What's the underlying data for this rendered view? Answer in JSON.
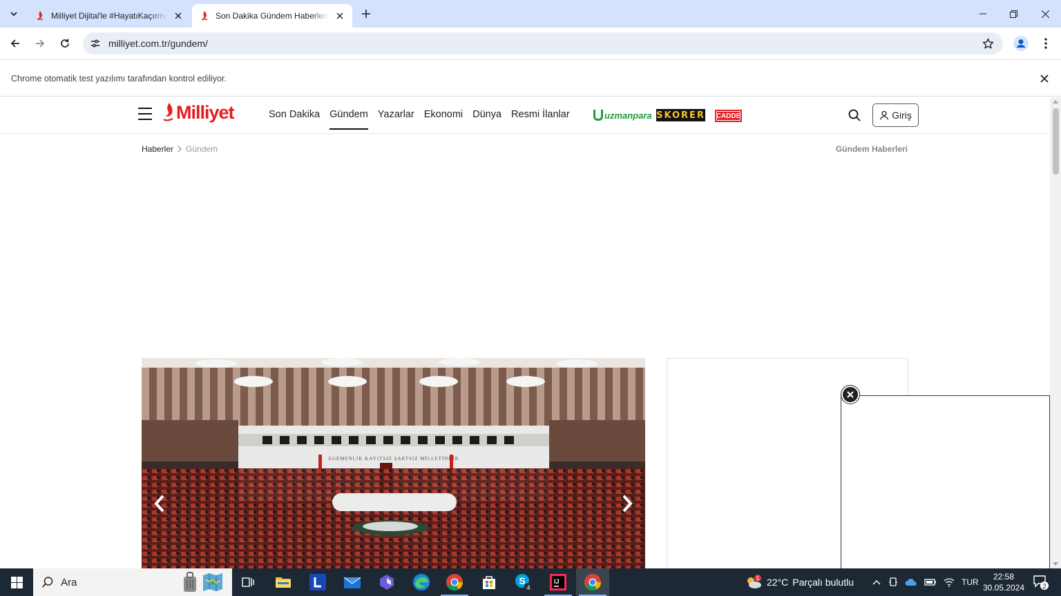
{
  "browser": {
    "tabs": [
      {
        "title": "Milliyet Dijital'le #HayatıKaçırma",
        "active": false
      },
      {
        "title": "Son Dakika Gündem Haberleri - Mi",
        "active": true
      }
    ],
    "url": "milliyet.com.tr/gundem/",
    "infobar_message": "Chrome otomatik test yazılımı tarafından kontrol ediliyor."
  },
  "site": {
    "logo_text": "Milliyet",
    "brand_color": "#e31e24",
    "nav": [
      "Son Dakika",
      "Gündem",
      "Yazarlar",
      "Ekonomi",
      "Dünya",
      "Resmi İlanlar"
    ],
    "active_nav": "Gündem",
    "partners": {
      "uzmanpara": "uzmanpara",
      "skorer": "SKORER",
      "cadde": "CADDE"
    },
    "login_label": "Giriş",
    "breadcrumb": {
      "home": "Haberler",
      "current": "Gündem"
    },
    "section_title": "Gündem Haberleri",
    "slider_sign_text": "EGEMENLİK KAYITSIZ ŞARTSIZ MİLLETİNDİR"
  },
  "taskbar": {
    "search_placeholder": "Ara",
    "skype_badge": "4",
    "weather": {
      "temp": "22°C",
      "desc": "Parçalı bulutlu",
      "badge": "1"
    },
    "language": "TUR",
    "time": "22:58",
    "date": "30.05.2024",
    "notifications": "2"
  }
}
